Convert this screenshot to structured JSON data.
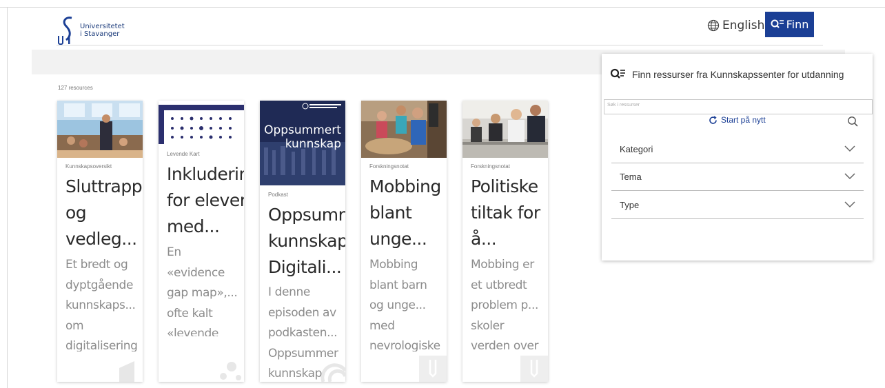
{
  "header": {
    "logo_text_line1": "Universitetet",
    "logo_text_line2": "i Stavanger",
    "language_label": "English",
    "search_button_label": "Finn"
  },
  "results": {
    "count_label": "127 resources"
  },
  "cards": [
    {
      "category": "Kunnskapsoversikt",
      "title": "Sluttrapp\nog\nvedleg...",
      "description": "Et bredt og\ndyptgående\nkunnskaps...\nom\ndigitalisering",
      "image": "conference-presentation-photo",
      "corner_icon": "document-icon"
    },
    {
      "category": "Levende Kart",
      "title": "Inkluderir\nfor elever\nmed...",
      "description": "En\n«evidence\ngap map»,...\nofte kalt\n«levende",
      "image": "evidence-gap-map-thumbnail",
      "corner_icon": "map-icon"
    },
    {
      "category": "Podkast",
      "title": "Oppsumn\nkunnskap\nDigitali...",
      "description": "I denne\nepisoden av\npodkasten...\nOppsummer\nkunnskap",
      "image": "podcast-cover",
      "image_line1": "Oppsummert",
      "image_line2": "kunnskap",
      "corner_icon": "podcast-icon"
    },
    {
      "category": "Forskningsnotat",
      "title": "Mobbing\nblant\nunge...",
      "description": "Mobbing\nblant barn\nog unge...\nmed\nnevrologiske",
      "image": "classroom-photo",
      "corner_icon": "bookmark-icon"
    },
    {
      "category": "Forskningsnotat",
      "title": "Politiske\ntiltak for\nå...",
      "description": "Mobbing er\net utbredt\nproblem p...\nskoler\nverden over",
      "image": "meeting-photo",
      "corner_icon": "bookmark-icon"
    }
  ],
  "panel": {
    "heading": "Finn ressurser fra Kunnskapssenter for utdanning",
    "search_placeholder": "Søk i ressurser",
    "restart_label": "Start på nytt",
    "filters": [
      {
        "label": "Kategori"
      },
      {
        "label": "Tema"
      },
      {
        "label": "Type"
      }
    ]
  },
  "colors": {
    "brand_blue": "#1b3f95",
    "text_grey": "#8c8c8c"
  }
}
